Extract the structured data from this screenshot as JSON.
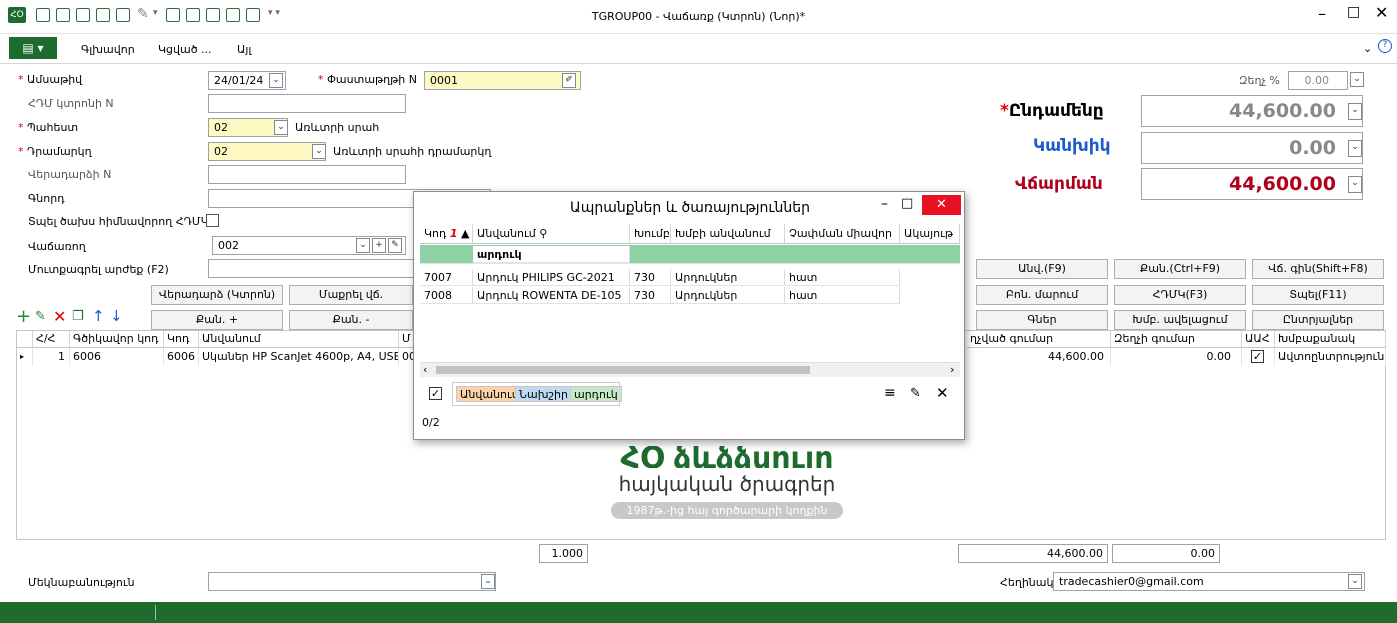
{
  "window": {
    "title": "TGROUP00 - Վաճառք (Կտրոն) (Նոր)*"
  },
  "ribbon": {
    "tabs": [
      "Գլխավոր",
      "Կցված ...",
      "Այլ"
    ]
  },
  "form": {
    "date_label": "Ամսաթիվ",
    "date_value": "24/01/24",
    "docnum_label": "Փաստաթղթի N",
    "docnum_value": "0001",
    "fiscal_label": "ՀԴՄ կտրոնի N",
    "warehouse_label": "Պահեստ",
    "warehouse_value": "02",
    "warehouse_name": "Առևտրի սրահ",
    "cashbox_label": "Դրամարկղ",
    "cashbox_value": "02",
    "cashbox_name": "Առևտրի սրահի դրամարկղ",
    "return_label": "Վերադարձի N",
    "buyer_label": "Գնորդ",
    "print_label": "Տպել ծախս հիմնավորող ՀԴՄԿ",
    "seller_label": "Վաճառող",
    "seller_value": "002",
    "enter_label": "Մուտքագրել արժեք (F2)",
    "discount_label": "Զեղչ %",
    "discount_value": "0.00",
    "comment_label": "Մեկնաբանություն",
    "author_label": "Հեղինակ",
    "author_value": "tradecashier0@gmail.com"
  },
  "totals": {
    "total_label": "Ընդամենը",
    "total_value": "44,600.00",
    "cash_label": "Կանխիկ",
    "cash_value": "0.00",
    "pay_label": "Վճարման",
    "pay_value": "44,600.00"
  },
  "colors": {
    "green": "#1e6b2e",
    "blue": "#1a5cc8",
    "red": "#b0001c",
    "yellow": "#fff9c4"
  },
  "buttons": {
    "return_check": "Վերադարձ (Կտրոն)",
    "clear_discount": "Մաքրել վճ.",
    "qty_plus": "Քան. +",
    "qty_minus": "Քան. -",
    "an": "Անվ.(F9)",
    "qty_ctrl": "Քան.(Ctrl+F9)",
    "price_shift": "Վճ. գին(Shift+F8)",
    "bon": "Բոն. մարում",
    "hdmk": "ՀԴՄԿ(F3)",
    "print": "Տպել(F11)",
    "prices": "Գներ",
    "group_add": "Խմբ. ավելացում",
    "choices": "Ընտրյալներ"
  },
  "grid": {
    "headers": [
      "Հ/Հ",
      "Գծիկավոր կոդ",
      "Կոդ",
      "Անվանում",
      "Մ",
      "ղչված գումար",
      "Զեղչի գումար",
      "ԱԱՀ",
      "Խմբաքանակ"
    ],
    "row": {
      "num": "1",
      "barcode": "6006",
      "code": "6006",
      "name": "Սկաներ HP ScanJet 4600p, A4, USB",
      "name_tail": "00",
      "amount": "44,600.00",
      "discount": "0.00",
      "batch": "Ավտոընտրություն"
    },
    "footer_qty": "1.000",
    "footer_amount": "44,600.00",
    "footer_discount": "0.00"
  },
  "watermark": {
    "line1": "ՀՕ ձևձձսուլը",
    "line2": "հայկական ծրագրեր",
    "line3": "1987թ.-ից հայ գործարարի կողքին"
  },
  "popup": {
    "title": "Ապրանքներ և ծառայություններ",
    "headers": [
      "Կոդ",
      "Անվանում",
      "Խումբ",
      "Խմբի անվանում",
      "Չափման միավոր",
      "Ակայութ"
    ],
    "filter": "արդուկ",
    "rows": [
      {
        "code": "7007",
        "name": "Արդուկ PHILIPS GC-2021",
        "group": "730",
        "group_name": "Արդուկներ",
        "unit": "հատ"
      },
      {
        "code": "7008",
        "name": "Արդուկ ROWENTA DE-105",
        "group": "730",
        "group_name": "Արդուկներ",
        "unit": "հատ"
      }
    ],
    "chips": [
      "Անվանում",
      "Նախշիր",
      "արդուկ"
    ],
    "count": "0/2"
  }
}
